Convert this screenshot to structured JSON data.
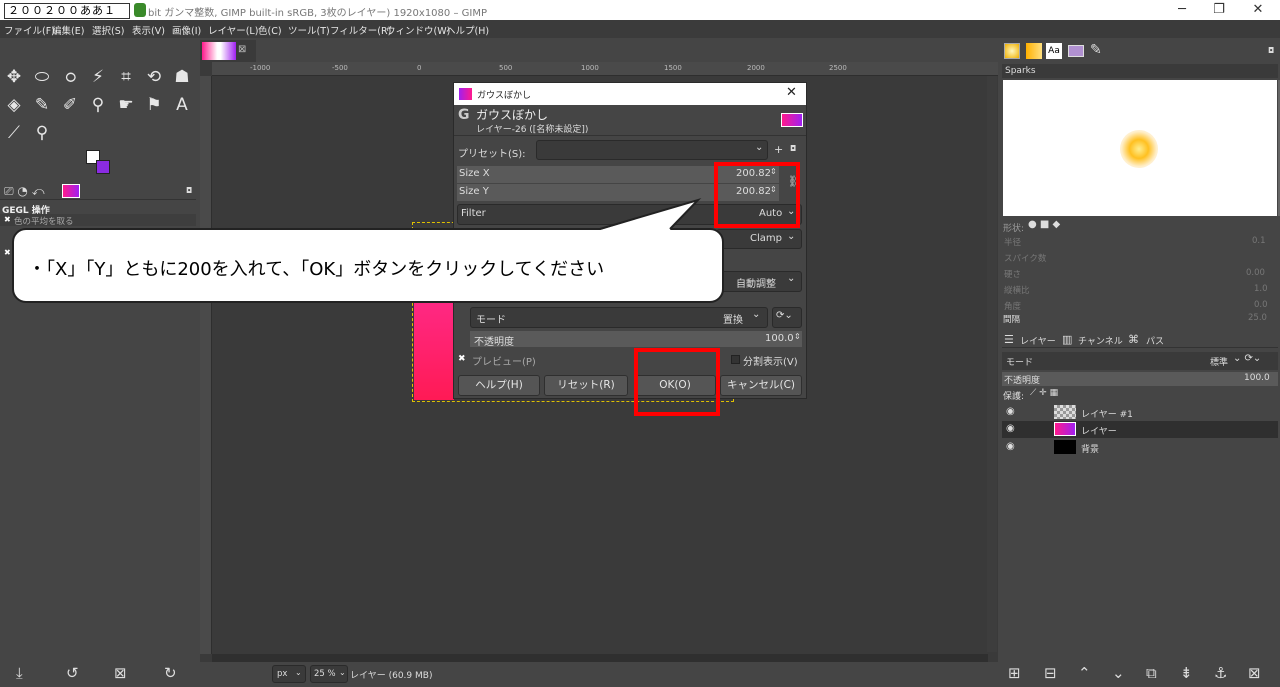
{
  "window": {
    "title": "bit ガンマ整数, GIMP built-in sRGB, 3枚のレイヤー) 1920x1080 – GIMP",
    "ime_text": "２００２００ああ１",
    "min_icon": "minimize-icon",
    "max_icon": "maximize-icon",
    "close_icon": "close-icon"
  },
  "menu": [
    "ファイル(F)",
    "編集(E)",
    "選択(S)",
    "表示(V)",
    "画像(I)",
    "レイヤー(L)",
    "色(C)",
    "ツール(T)",
    "フィルター(R)",
    "ウィンドウ(W)",
    "ヘルプ(H)"
  ],
  "left_panel": {
    "gegl_label": "GEGL 操作",
    "gegl_item": "色の平均を取る"
  },
  "ruler": [
    "-1000",
    "-500",
    "0",
    "500",
    "1000",
    "1500",
    "2000",
    "2500"
  ],
  "status": {
    "unit": "px",
    "zoom": "25 %",
    "info": "レイヤー (60.9 MB)"
  },
  "dialog": {
    "window_title": "ガウスぼかし",
    "header_title": "ガウスぼかし",
    "header_sub": "レイヤー-26 ([名称未設定])",
    "preset_label": "プリセット(S):",
    "size_x_label": "Size X",
    "size_x_value": "200.82",
    "size_y_label": "Size Y",
    "size_y_value": "200.82",
    "filter_label": "Filter",
    "filter_value": "Auto",
    "abyss_value": "Clamp",
    "clip_value": "自動調整",
    "mode_label": "モード",
    "mode_value": "置換",
    "opacity_label": "不透明度",
    "opacity_value": "100.0",
    "preview_label": "プレビュー(P)",
    "split_label": "分割表示(V)",
    "help_button": "ヘルプ(H)",
    "reset_button": "リセット(R)",
    "ok_button": "OK(O)",
    "cancel_button": "キャンセル(C)"
  },
  "callout": {
    "text": "・「X」「Y」ともに200を入れて、「OK」ボタンをクリックしてください"
  },
  "right_panel": {
    "brush_name": "Sparks",
    "shape_label": "形状:",
    "dim_labels": [
      "半径",
      "スパイク数",
      "硬さ",
      "縦横比",
      "角度",
      "間隔"
    ],
    "dim_values": [
      "0.1",
      "",
      "0.00",
      "1.0",
      "0.0",
      "25.0"
    ],
    "spacing_label": "間隔",
    "tabs": [
      "レイヤー",
      "チャンネル",
      "パス"
    ],
    "mode_label": "モード",
    "mode_value": "標準",
    "opacity_label": "不透明度",
    "opacity_value": "100.0",
    "lock_label": "保護:",
    "layers": [
      "レイヤー #1",
      "レイヤー",
      "背景"
    ]
  }
}
